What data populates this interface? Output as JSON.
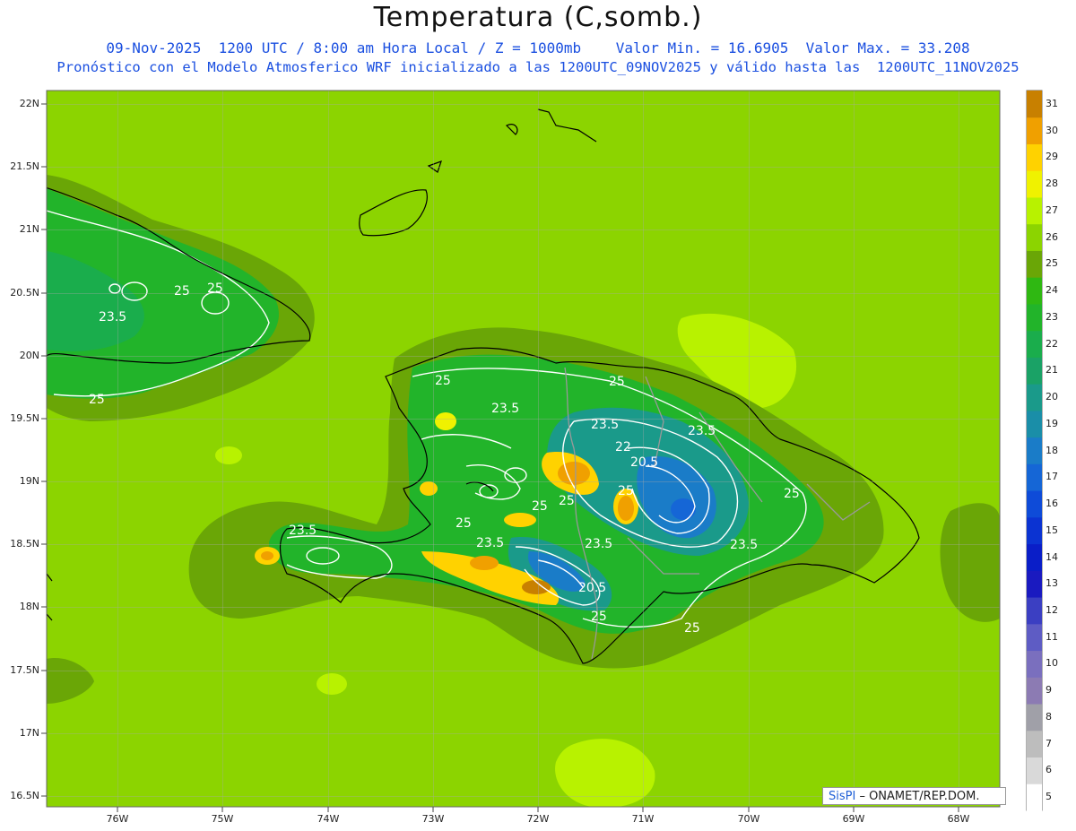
{
  "header": {
    "title": "Temperatura (C,somb.)",
    "line1": "09-Nov-2025  1200 UTC / 8:00 am Hora Local / Z = 1000mb    Valor Min. = 16.6905  Valor Max. = 33.208",
    "line2": "Pronóstico con el Modelo Atmosferico WRF inicializado a las 1200UTC_09NOV2025 y válido hasta las  1200UTC_11NOV2025"
  },
  "axes": {
    "lat_labels": [
      "22N",
      "21.5N",
      "21N",
      "20.5N",
      "20N",
      "19.5N",
      "19N",
      "18.5N",
      "18N",
      "17.5N",
      "17N",
      "16.5N"
    ],
    "lon_labels": [
      "76W",
      "75W",
      "74W",
      "73W",
      "72W",
      "71W",
      "70W",
      "69W",
      "68W"
    ]
  },
  "colorbar": {
    "levels": [
      "5",
      "6",
      "7",
      "8",
      "9",
      "10",
      "11",
      "12",
      "13",
      "14",
      "15",
      "16",
      "17",
      "18",
      "19",
      "20",
      "21",
      "22",
      "23",
      "24",
      "25",
      "26",
      "27",
      "28",
      "29",
      "30",
      "31"
    ],
    "colors": [
      "#ffffff",
      "#d9d9d9",
      "#bdbdbd",
      "#a0a0a8",
      "#8c7bb3",
      "#7a6fbe",
      "#5e5cc4",
      "#3b3fc2",
      "#1a1ac0",
      "#0a1ec8",
      "#0b33d2",
      "#0e4bd8",
      "#1566d6",
      "#1a7cc8",
      "#1a8ea8",
      "#1a9a8a",
      "#1aa266",
      "#1aad4c",
      "#22b42a",
      "#2fb812",
      "#6aa606",
      "#8cd400",
      "#b8f200",
      "#f0f200",
      "#ffd200",
      "#f0a000",
      "#c88000"
    ]
  },
  "contour_labels": [
    "25",
    "25",
    "23.5",
    "25",
    "25",
    "23.5",
    "25",
    "23.5",
    "23.5",
    "22",
    "20.5",
    "23.5",
    "25",
    "25",
    "25",
    "25",
    "25",
    "23.5",
    "23.5",
    "23.5",
    "20.5",
    "25",
    "25",
    "25"
  ],
  "credit": {
    "brand": "SisPI",
    "text": " – ONAMET/REP.DOM."
  }
}
